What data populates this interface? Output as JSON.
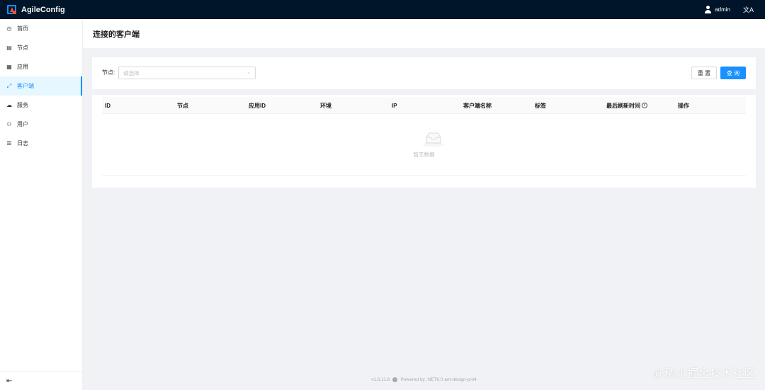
{
  "app": {
    "name": "AgileConfig"
  },
  "header": {
    "username": "admin",
    "lang_glyph": "文A"
  },
  "sidebar": {
    "items": [
      {
        "label": "首页",
        "icon": "dashboard-icon",
        "glyph": "◷"
      },
      {
        "label": "节点",
        "icon": "node-icon",
        "glyph": "▤"
      },
      {
        "label": "应用",
        "icon": "app-icon",
        "glyph": "▦"
      },
      {
        "label": "客户端",
        "icon": "client-icon",
        "glyph": "⤢",
        "active": true
      },
      {
        "label": "服务",
        "icon": "cloud-icon",
        "glyph": "☁"
      },
      {
        "label": "用户",
        "icon": "user-icon",
        "glyph": "⚇"
      },
      {
        "label": "日志",
        "icon": "log-icon",
        "glyph": "☰"
      }
    ],
    "collapse_glyph": "⇤"
  },
  "page": {
    "title": "连接的客户端"
  },
  "search": {
    "node_label": "节点:",
    "node_placeholder": "请选择",
    "reset_label": "重 置",
    "query_label": "查 询"
  },
  "table": {
    "columns": [
      "ID",
      "节点",
      "应用ID",
      "环境",
      "IP",
      "客户端名称",
      "标签",
      "最后刷新时间",
      "操作"
    ],
    "empty_text": "暂无数据"
  },
  "footer": {
    "version": "v1.6.11.6",
    "powered": "Powered by .NET6.0 ant-design-pro4"
  },
  "watermark": "@稀土掘金技术社区",
  "colors": {
    "primary": "#1890ff",
    "header_bg": "#001529",
    "page_bg": "#f0f2f5"
  }
}
